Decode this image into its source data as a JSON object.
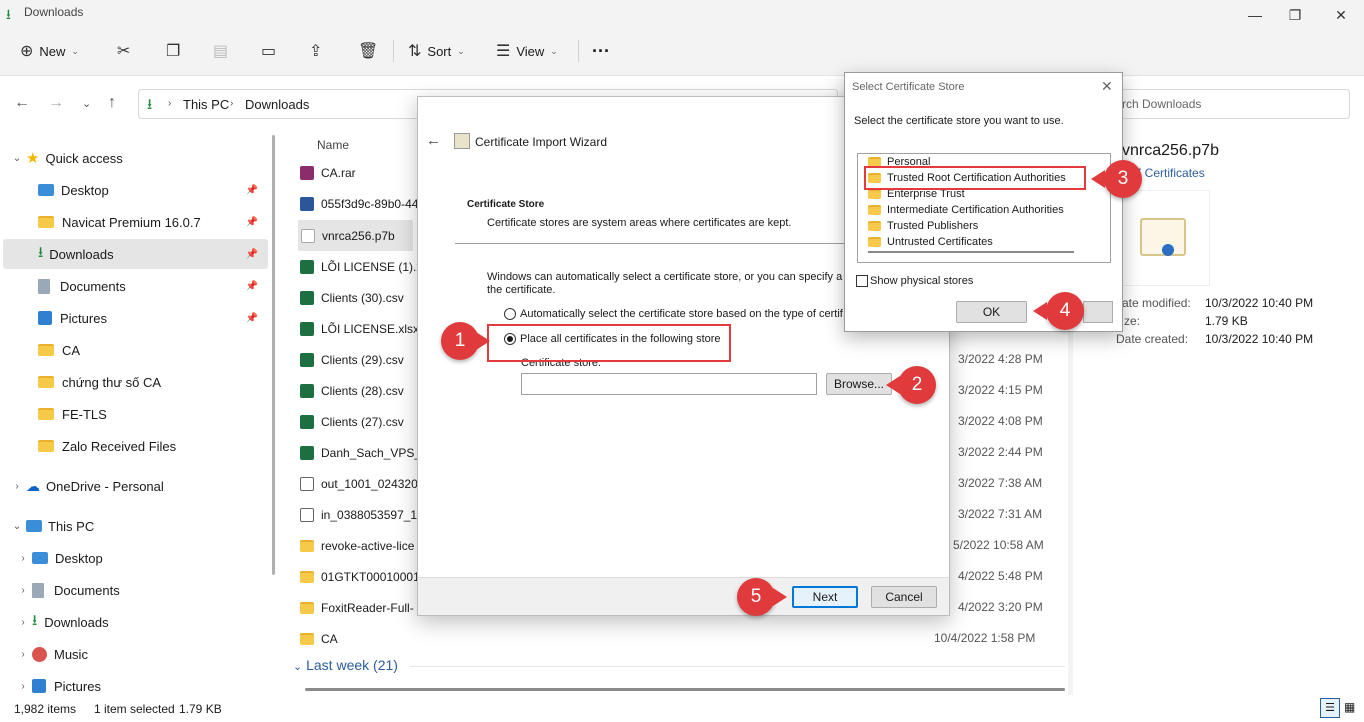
{
  "window": {
    "title": "Downloads"
  },
  "toolbar": {
    "new": "New",
    "sort": "Sort",
    "view": "View"
  },
  "address": {
    "this_pc": "This PC",
    "folder": "Downloads",
    "search_placeholder": "rch Downloads"
  },
  "sidebar": {
    "quick_access": "Quick access",
    "quick_items": [
      "Desktop",
      "Navicat Premium 16.0.7",
      "Downloads",
      "Documents",
      "Pictures",
      "CA",
      "chứng thư số CA",
      "FE-TLS",
      "Zalo Received Files"
    ],
    "onedrive": "OneDrive - Personal",
    "this_pc": "This PC",
    "pc_items": [
      "Desktop",
      "Documents",
      "Downloads",
      "Music",
      "Pictures"
    ]
  },
  "filelist": {
    "col_name": "Name",
    "files": [
      {
        "name": "CA.rar",
        "type": "rar",
        "date": ""
      },
      {
        "name": "055f3d9c-89b0-44",
        "type": "word",
        "date": ""
      },
      {
        "name": "vnrca256.p7b",
        "type": "cert",
        "date": ""
      },
      {
        "name": "LÕI LICENSE (1).x",
        "type": "xl",
        "date": ""
      },
      {
        "name": "Clients (30).csv",
        "type": "xl",
        "date": ""
      },
      {
        "name": "LÕI LICENSE.xlsx",
        "type": "xl",
        "date": ""
      },
      {
        "name": "Clients (29).csv",
        "type": "xl",
        "date": "3/2022 4:28 PM"
      },
      {
        "name": "Clients (28).csv",
        "type": "xl",
        "date": "3/2022 4:15 PM"
      },
      {
        "name": "Clients (27).csv",
        "type": "xl",
        "date": "3/2022 4:08 PM"
      },
      {
        "name": "Danh_Sach_VPS_L",
        "type": "xl",
        "date": "3/2022 2:44 PM"
      },
      {
        "name": "out_1001_0243202",
        "type": "file",
        "date": "3/2022 7:38 AM"
      },
      {
        "name": "in_0388053597_10",
        "type": "file",
        "date": "3/2022 7:31 AM"
      },
      {
        "name": "revoke-active-lice",
        "type": "folder",
        "date": "5/2022 10:58 AM"
      },
      {
        "name": "01GTKT000100012",
        "type": "folder",
        "date": "4/2022 5:48 PM"
      },
      {
        "name": "FoxitReader-Full-",
        "type": "folder",
        "date": "4/2022 3:20 PM"
      },
      {
        "name": "CA",
        "type": "folder",
        "date": "10/4/2022 1:58 PM"
      }
    ],
    "group_last_week": "Last week (21)"
  },
  "detail": {
    "filename": "vnrca256.p7b",
    "subtitle": "#7 Certificates",
    "modified_label": "ate modified:",
    "modified": "10/3/2022 10:40 PM",
    "size_label": "ze:",
    "size": "1.79 KB",
    "created_label": "Date created:",
    "created": "10/3/2022 10:40 PM"
  },
  "status": {
    "items": "1,982 items",
    "selected": "1 item selected",
    "size": "1.79 KB"
  },
  "wizard": {
    "title": "Certificate Import Wizard",
    "heading": "Certificate Store",
    "subheading": "Certificate stores are system areas where certificates are kept.",
    "desc1": "Windows can automatically select a certificate store, or you can specify a l",
    "desc2": "the certificate.",
    "opt_auto": "Automatically select the certificate store based on the type of certif",
    "opt_place": "Place all certificates in the following store",
    "store_label": "Certificate store:",
    "browse": "Browse...",
    "next": "Next",
    "cancel": "Cancel"
  },
  "store_dialog": {
    "title": "Select Certificate Store",
    "prompt": "Select the certificate store you want to use.",
    "stores": [
      "Personal",
      "Trusted Root Certification Authorities",
      "Enterprise Trust",
      "Intermediate Certification Authorities",
      "Trusted Publishers",
      "Untrusted Certificates"
    ],
    "show_physical": "Show physical stores",
    "ok": "OK"
  },
  "callouts": [
    "1",
    "2",
    "3",
    "4",
    "5"
  ],
  "colors": {
    "accent": "#0078d7",
    "callout": "#e03a3c",
    "folder": "#f7c948"
  }
}
